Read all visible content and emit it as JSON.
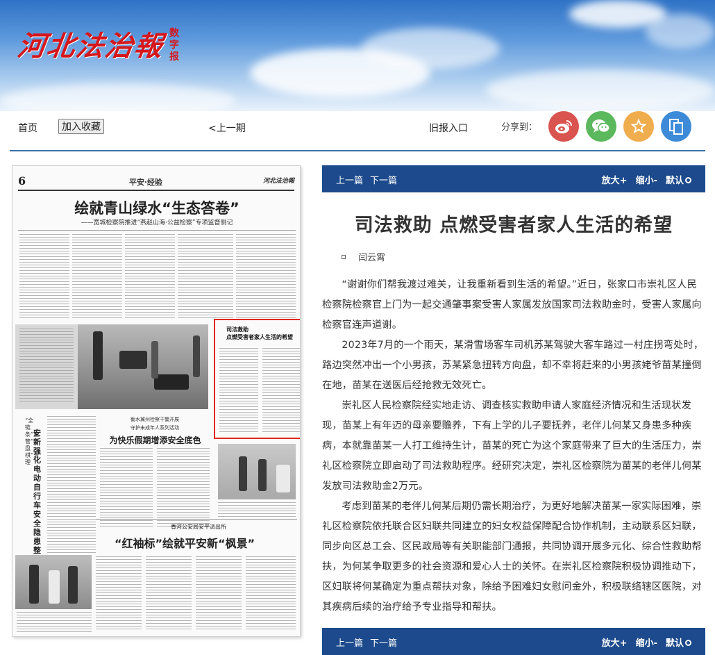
{
  "masthead": {
    "logo_text": "河北法治報",
    "logo_sub": "数字报",
    "colors": {
      "logo_red": "#d4171c",
      "sky_top": "#2f72c6",
      "toolbar_blue": "#1c4a8c"
    }
  },
  "nav": {
    "home": "首页",
    "favorite": "加入收藏",
    "prev_issue": "<上一期",
    "archive": "旧报入口",
    "share_label": "分享到：",
    "share_icons": [
      {
        "name": "weibo-icon",
        "color": "#d9534f"
      },
      {
        "name": "wechat-icon",
        "color": "#5cb85c"
      },
      {
        "name": "star-icon",
        "color": "#f0ad4e"
      },
      {
        "name": "copy-icon",
        "color": "#3d8bd8"
      }
    ]
  },
  "newspaper": {
    "page_number": "6",
    "section": "平安·经验",
    "mini_logo": "河北法治報",
    "headline": "绘就青山绿水“生态答卷”",
    "subheadline": "——宽城检察院推进“燕赵山海·公益检察”专项监督侧记",
    "highlight_title_1": "司法救助",
    "highlight_title_2": "点燃受害者家人生活的希望",
    "mid_small": "衡水冀州检察干警开展",
    "mid_small_2": "守护未成年人系列活动",
    "mid_title": "为快乐假期增添安全底色",
    "vertical_title": "安新强化电动自行车安全隐患整治",
    "vertical_subtitle": "“全链条”监管“一盘棋”治理",
    "bottom_small": "香河公安局安平派出所",
    "bottom_title": "“红袖标”绘就平安新“枫景”"
  },
  "toolbar": {
    "prev": "上一篇",
    "next": "下一篇",
    "zoom_in": "放大+",
    "zoom_out": "缩小-",
    "default": "默认"
  },
  "article": {
    "title": "司法救助 点燃受害者家人生活的希望",
    "author": "闫云霄",
    "paragraphs": [
      "“谢谢你们帮我渡过难关，让我重新看到生活的希望。”近日，张家口市崇礼区人民检察院检察官上门为一起交通肇事案受害人家属发放国家司法救助金时，受害人家属向检察官连声道谢。",
      "2023年7月的一个雨天，某滑雪场客车司机苏某驾驶大客车路过一村庄拐弯处时，路边突然冲出一个小男孩，苏某紧急扭转方向盘，却不幸将赶来的小男孩姥爷苗某撞倒在地，苗某在送医后经抢救无效死亡。",
      "崇礼区人民检察院经实地走访、调查核实救助申请人家庭经济情况和生活现状发现，苗某上有年迈的母亲要赡养，下有上学的儿子要抚养，老伴儿何某又身患多种疾病，本就靠苗某一人打工维持生计，苗某的死亡为这个家庭带来了巨大的生活压力，崇礼区检察院立即启动了司法救助程序。经研究决定，崇礼区检察院为苗某的老伴儿何某发放司法救助金2万元。",
      "考虑到苗某的老伴儿何某后期仍需长期治疗，为更好地解决苗某一家实际困难，崇礼区检察院依托联合区妇联共同建立的妇女权益保障配合协作机制，主动联系区妇联，同步向区总工会、区民政局等有关职能部门通报，共同协调开展多元化、综合性救助帮扶，为何某争取更多的社会资源和爱心人士的关怀。在崇礼区检察院积极协调推动下，区妇联将何某确定为重点帮扶对象，除给予困难妇女慰问金外，积极联络辖区医院，对其疾病后续的治疗给予专业指导和帮扶。"
    ]
  }
}
